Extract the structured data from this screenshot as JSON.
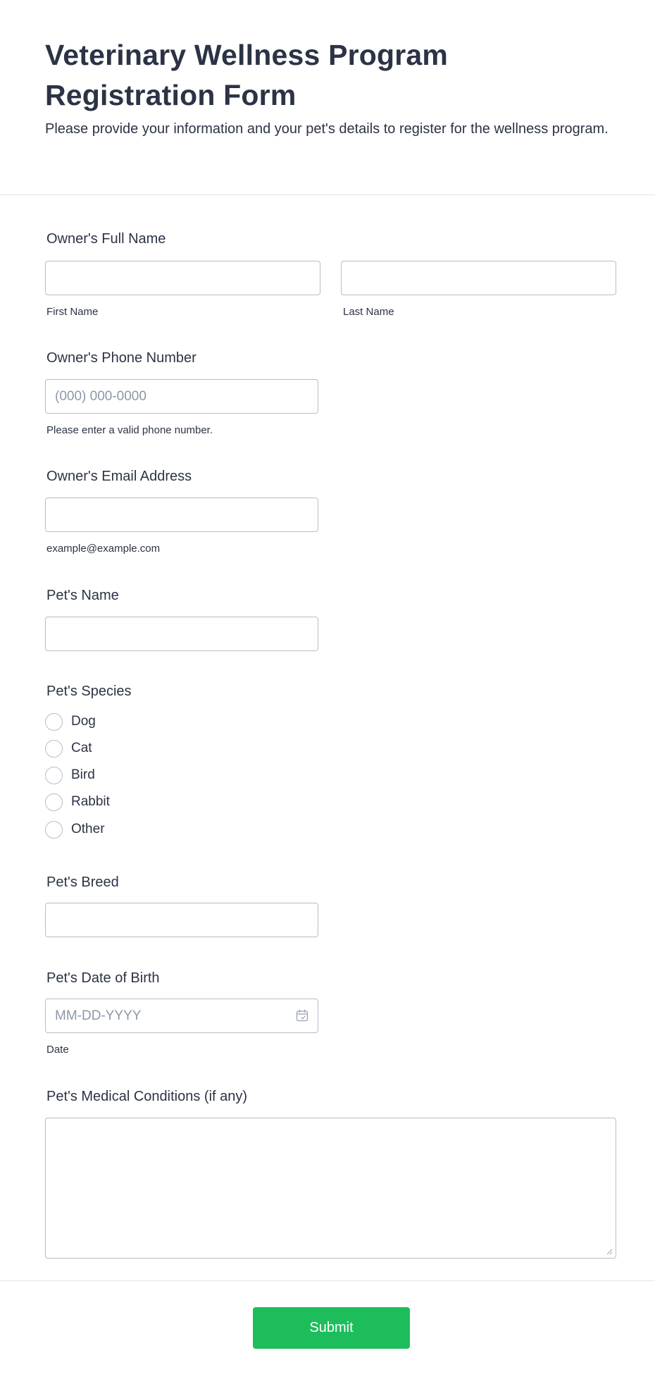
{
  "form": {
    "title": "Veterinary Wellness Program Registration Form",
    "description": "Please provide your information and your pet's details to register for the wellness program."
  },
  "owner_name": {
    "label": "Owner's Full Name",
    "first_sublabel": "First Name",
    "last_sublabel": "Last Name",
    "first_value": "",
    "last_value": ""
  },
  "owner_phone": {
    "label": "Owner's Phone Number",
    "placeholder": "(000) 000-0000",
    "sublabel": "Please enter a valid phone number."
  },
  "owner_email": {
    "label": "Owner's Email Address",
    "sublabel": "example@example.com"
  },
  "pet_name": {
    "label": "Pet's Name"
  },
  "pet_species": {
    "label": "Pet's Species",
    "options": [
      "Dog",
      "Cat",
      "Bird",
      "Rabbit",
      "Other"
    ]
  },
  "pet_breed": {
    "label": "Pet's Breed"
  },
  "pet_dob": {
    "label": "Pet's Date of Birth",
    "placeholder": "MM-DD-YYYY",
    "sublabel": "Date",
    "icon": "calendar-icon"
  },
  "pet_conditions": {
    "label": "Pet's Medical Conditions (if any)"
  },
  "submit": {
    "label": "Submit",
    "color": "#1dbd5c"
  }
}
